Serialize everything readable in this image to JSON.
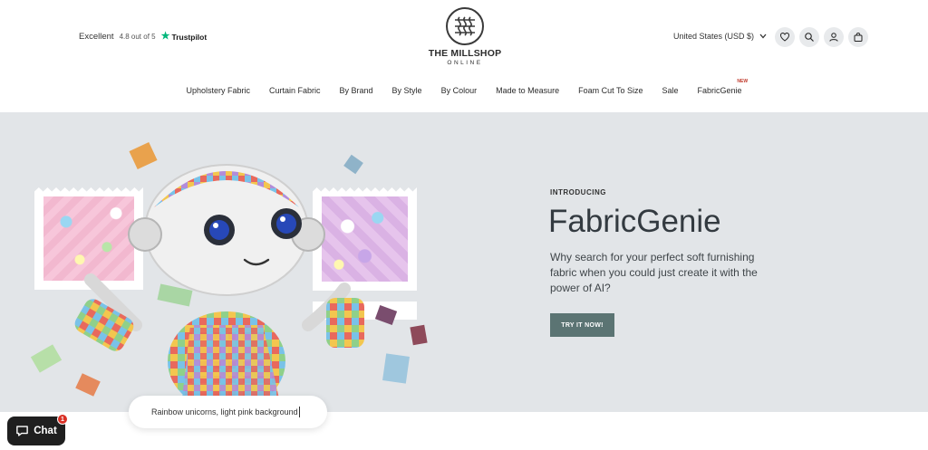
{
  "trustbar": {
    "excellent": "Excellent",
    "rating": "4.8 out of 5",
    "brand": "Trustpilot",
    "star_color": "#00b67a"
  },
  "logo": {
    "name": "THE MILLSHOP",
    "sub": "ONLINE"
  },
  "header": {
    "currency": "United States (USD $)",
    "icons": [
      "heart-icon",
      "search-icon",
      "account-icon",
      "bag-icon"
    ]
  },
  "nav": {
    "items": [
      {
        "label": "Upholstery Fabric"
      },
      {
        "label": "Curtain Fabric"
      },
      {
        "label": "By Brand"
      },
      {
        "label": "By Style"
      },
      {
        "label": "By Colour"
      },
      {
        "label": "Made to Measure"
      },
      {
        "label": "Foam Cut To Size"
      },
      {
        "label": "Sale"
      },
      {
        "label": "FabricGenie",
        "badge": "NEW"
      }
    ]
  },
  "hero": {
    "eyebrow": "INTRODUCING",
    "title": "FabricGenie",
    "description": "Why search for your perfect soft furnishing fabric when you could just create it with the power of AI?",
    "cta": "TRY IT NOW!",
    "cta_color": "#5b7473",
    "background": "#e2e5e8"
  },
  "prompt": {
    "text": "Rainbow unicorns, light pink background"
  },
  "chat": {
    "label": "Chat",
    "badge": "1"
  }
}
